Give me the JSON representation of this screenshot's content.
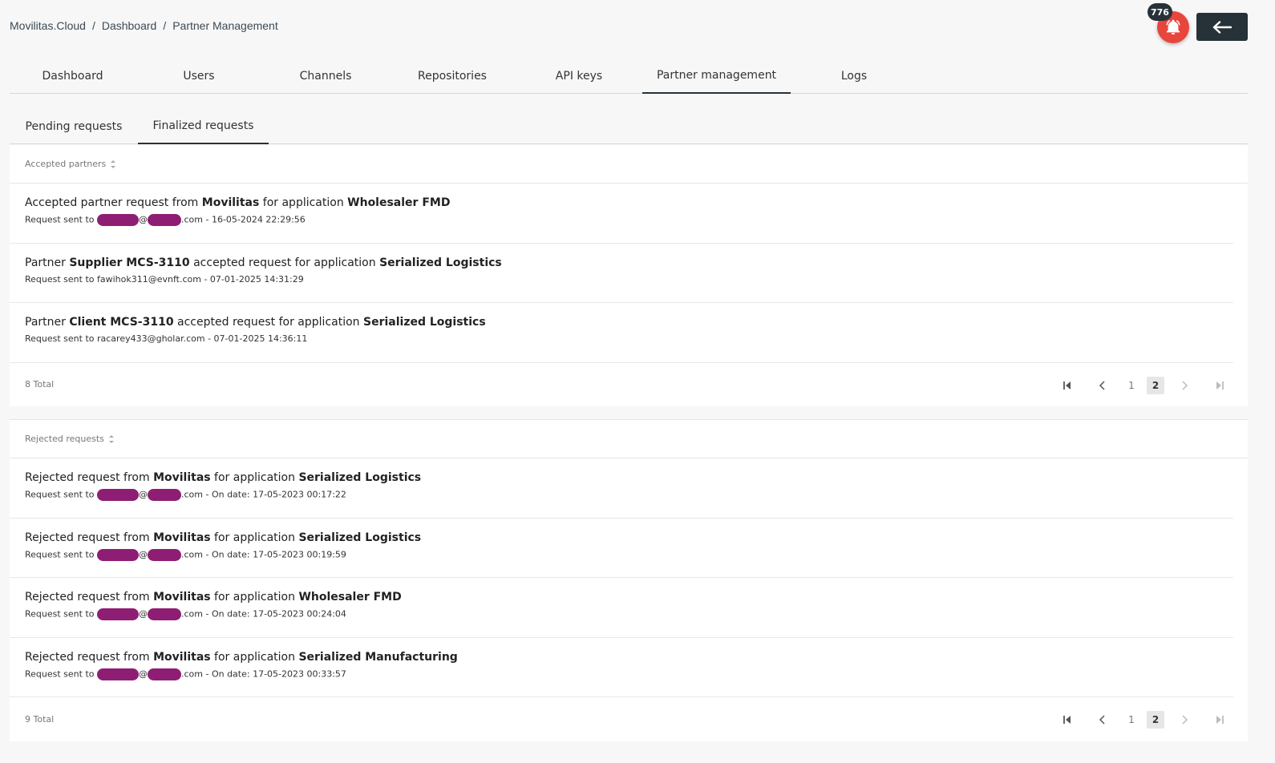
{
  "breadcrumb": [
    "Movilitas.Cloud",
    "Dashboard",
    "Partner Management"
  ],
  "notifications": {
    "count": "776"
  },
  "main_tabs": [
    "Dashboard",
    "Users",
    "Channels",
    "Repositories",
    "API keys",
    "Partner management",
    "Logs"
  ],
  "main_tabs_active": "Partner management",
  "sub_tabs": [
    "Pending requests",
    "Finalized requests"
  ],
  "sub_tabs_active": "Finalized requests",
  "accepted": {
    "header": "Accepted partners",
    "rows": [
      {
        "t1": "Accepted partner request from ",
        "b1": "Movilitas",
        "t2": " for application ",
        "b2": "Wholesaler FMD",
        "t3": "",
        "sub_prefix": "Request sent to ",
        "sub_email": "",
        "sub_redacted": true,
        "sub_suffix": ".com - 16-05-2024 22:29:56"
      },
      {
        "t1": "Partner ",
        "b1": "Supplier MCS-3110",
        "t2": " accepted request for application ",
        "b2": "Serialized Logistics",
        "t3": "",
        "sub_prefix": "Request sent to ",
        "sub_email": "fawihok311@evnft.com",
        "sub_redacted": false,
        "sub_suffix": " - 07-01-2025 14:31:29"
      },
      {
        "t1": "Partner ",
        "b1": "Client MCS-3110",
        "t2": " accepted request for application ",
        "b2": "Serialized Logistics",
        "t3": "",
        "sub_prefix": "Request sent to ",
        "sub_email": "racarey433@gholar.com",
        "sub_redacted": false,
        "sub_suffix": " - 07-01-2025 14:36:11"
      }
    ],
    "total": "8 Total",
    "pages": [
      "1",
      "2"
    ],
    "current_page": "2"
  },
  "rejected": {
    "header": "Rejected requests",
    "rows": [
      {
        "t1": "Rejected request from ",
        "b1": "Movilitas",
        "t2": " for application ",
        "b2": "Serialized Logistics",
        "sub_prefix": "Request sent to ",
        "sub_redacted": true,
        "sub_suffix": ".com - On date: 17-05-2023 00:17:22"
      },
      {
        "t1": "Rejected request from ",
        "b1": "Movilitas",
        "t2": " for application ",
        "b2": "Serialized Logistics",
        "sub_prefix": "Request sent to ",
        "sub_redacted": true,
        "sub_suffix": ".com - On date: 17-05-2023 00:19:59"
      },
      {
        "t1": "Rejected request from ",
        "b1": "Movilitas",
        "t2": " for application ",
        "b2": "Wholesaler FMD",
        "sub_prefix": "Request sent to ",
        "sub_redacted": true,
        "sub_suffix": ".com - On date: 17-05-2023 00:24:04"
      },
      {
        "t1": "Rejected request from ",
        "b1": "Movilitas",
        "t2": " for application ",
        "b2": "Serialized Manufacturing",
        "sub_prefix": "Request sent to ",
        "sub_redacted": true,
        "sub_suffix": ".com - On date: 17-05-2023 00:33:57"
      }
    ],
    "total": "9 Total",
    "pages": [
      "1",
      "2"
    ],
    "current_page": "2"
  },
  "colors": {
    "accent": "#263238",
    "bell": "#e8453c",
    "redaction": "#8e1e73"
  },
  "icons": {
    "bell": "bell-icon",
    "back": "arrow-left-icon",
    "first": "first-page-icon",
    "prev": "chevron-left-icon",
    "next": "chevron-right-icon",
    "last": "last-page-icon",
    "sort": "sort-icon"
  }
}
